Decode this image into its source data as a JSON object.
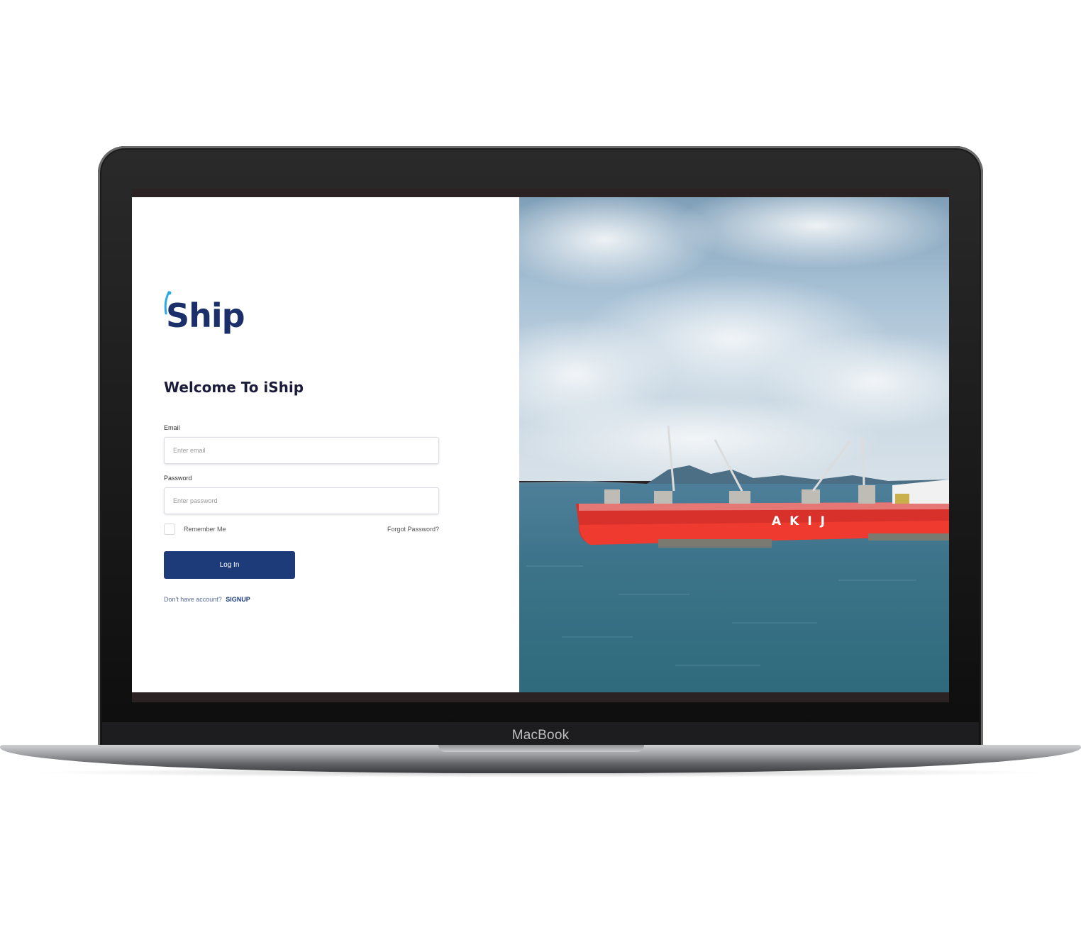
{
  "app": {
    "logo_text": "Ship",
    "welcome_title": "Welcome To iShip"
  },
  "form": {
    "email_label": "Email",
    "email_placeholder": "Enter email",
    "email_value": "",
    "password_label": "Password",
    "password_placeholder": "Enter password",
    "password_value": "",
    "remember_label": "Remember Me",
    "remember_checked": false,
    "forgot_label": "Forgot Password?",
    "login_label": "Log In",
    "signup_prompt": "Don't have account?",
    "signup_label": "SIGNUP"
  },
  "photo": {
    "hull_text": "AKIJ"
  },
  "device": {
    "label": "MacBook"
  },
  "colors": {
    "brand_navy": "#1d3b78",
    "logo_accent": "#29a9e1",
    "hull_red": "#e2312b"
  }
}
